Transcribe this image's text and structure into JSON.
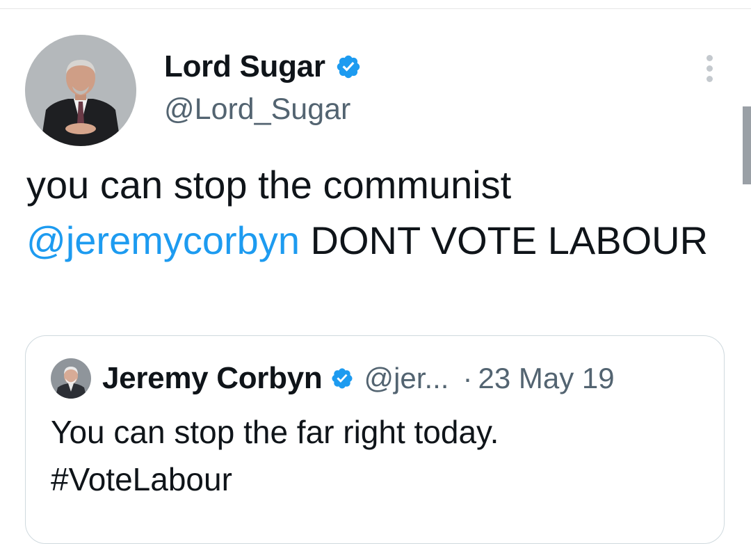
{
  "tweet": {
    "author": {
      "name": "Lord Sugar",
      "handle": "@Lord_Sugar",
      "avatar_icon": "profile-photo",
      "verified_icon": "verified-badge-icon"
    },
    "text_parts": [
      "you can stop the communist",
      "@jeremycorbyn",
      " DONT VOTE LABOUR"
    ],
    "more_icon": "more-options-icon"
  },
  "quoted_tweet": {
    "author": {
      "name": "Jeremy Corbyn",
      "handle": "@jer...",
      "avatar_icon": "profile-photo",
      "verified_icon": "verified-badge-icon"
    },
    "separator": "·",
    "date": "23 May 19",
    "text_line1": "You can stop the far right today.",
    "hashtag": "#VoteLabour"
  },
  "colors": {
    "link": "#1d9bf0",
    "text": "#0f1419",
    "secondary": "#536471",
    "verified": "#1d9bf0",
    "border": "#cfd9de"
  }
}
